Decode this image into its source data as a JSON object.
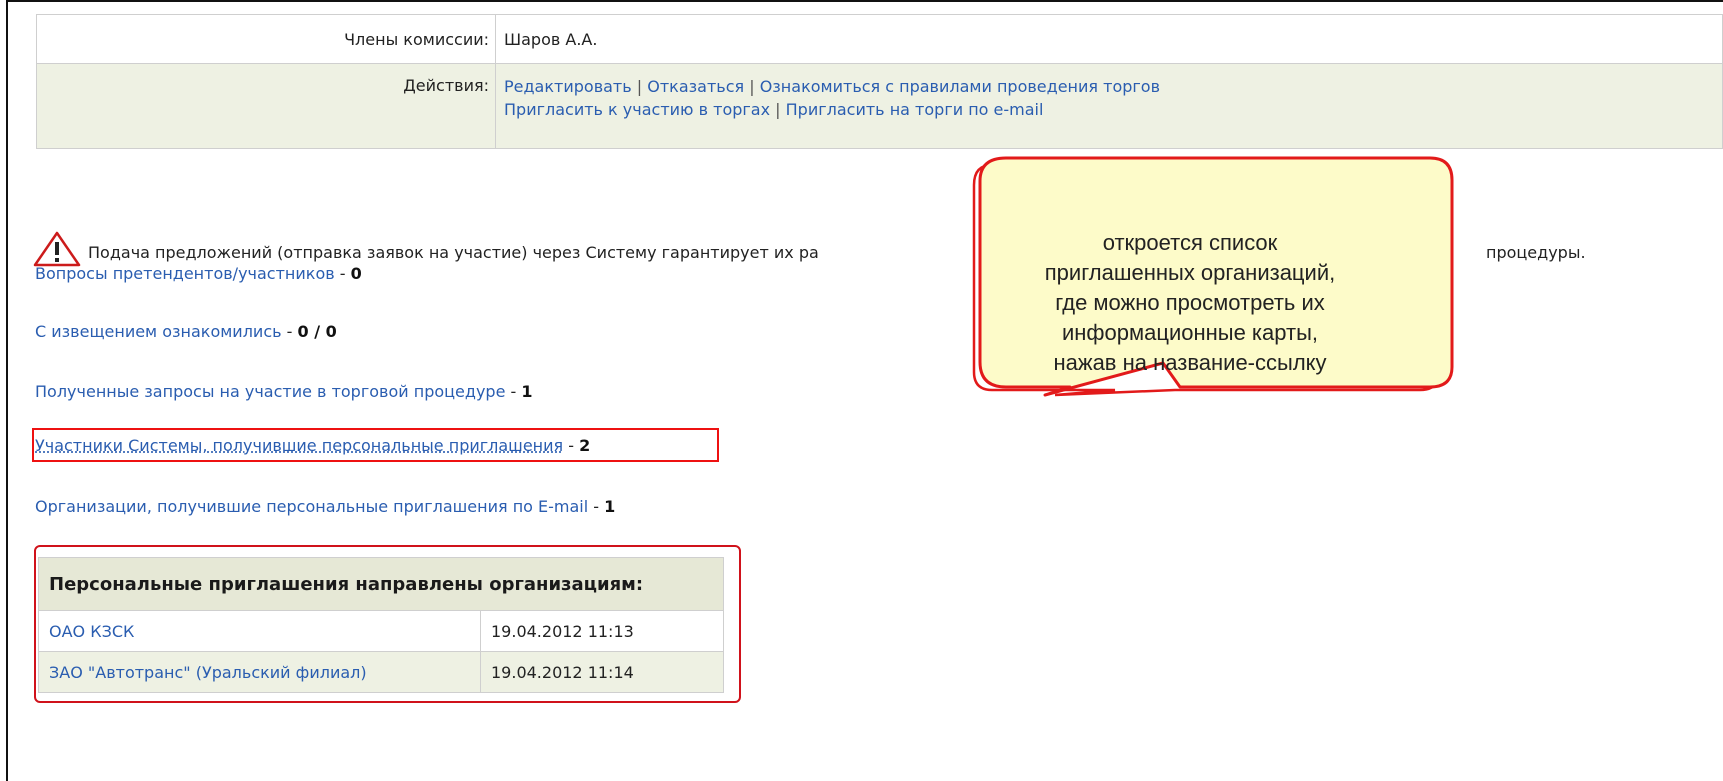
{
  "props": {
    "members_label": "Члены комиссии:",
    "members_value": "Шаров А.А.",
    "actions_label": "Действия:",
    "actions": [
      "Редактировать",
      "Отказаться",
      "Ознакомиться с правилами проведения торгов",
      "Пригласить к участию в торгах",
      "Пригласить на торги по e-mail"
    ],
    "separator": "|"
  },
  "notice": {
    "text_before": "Подача предложений (отправка заявок на участие) через Систему гарантирует их ра",
    "text_after": "процедуры."
  },
  "links": [
    {
      "label": "Вопросы претендентов/участников",
      "count": "0"
    },
    {
      "label": "С извещением ознакомились",
      "count": "0 / 0"
    },
    {
      "label": "Полученные запросы на участие в торговой процедуре",
      "count": "1"
    },
    {
      "label": "Участники Системы, получившие персональные приглашения",
      "count": "2"
    },
    {
      "label": "Организации, получившие персональные приглашения по E-mail",
      "count": "1"
    }
  ],
  "dash": " - ",
  "invitations": {
    "header": "Персональные приглашения направлены организациям:",
    "rows": [
      {
        "org": "ОАО КЗСК",
        "date": "19.04.2012 11:13"
      },
      {
        "org": "ЗАО \"Автотранс\" (Уральский филиал)",
        "date": "19.04.2012 11:14"
      }
    ]
  },
  "callout": {
    "lines": [
      "откроется список",
      "приглашенных организаций,",
      "где можно просмотреть их",
      "информационные карты,",
      "нажав на название-ссылку"
    ]
  },
  "colors": {
    "link": "#2a5db0",
    "highlight": "#e11111",
    "callout_fill": "#fdfbc9",
    "callout_border": "#e21a1a",
    "row_alt": "#eef1e3"
  }
}
